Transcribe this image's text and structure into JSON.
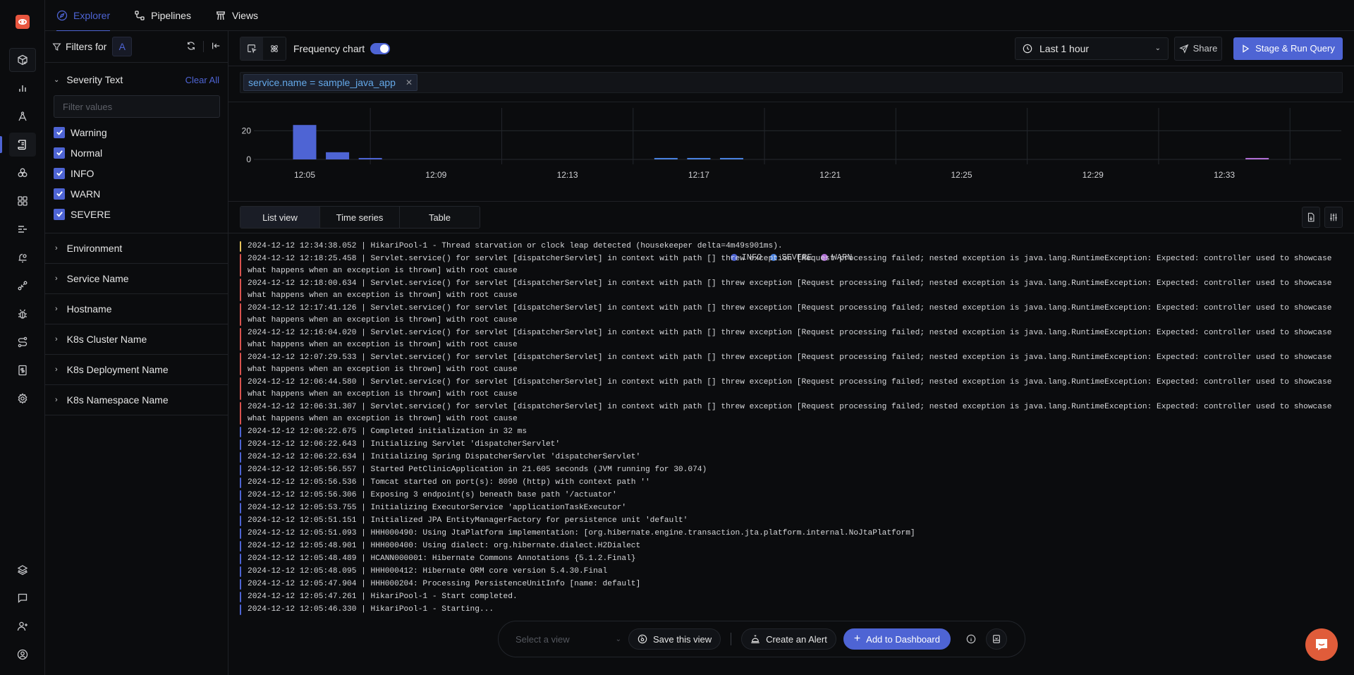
{
  "nav": {
    "top_icons": [
      "new-package-icon",
      "bar-chart-icon",
      "traces-compass-icon",
      "logs-scroll-icon",
      "exceptions-icon",
      "dashboards-grid-icon",
      "messaging-queues-icon",
      "alerts-bell-icon",
      "integrations-plug-icon",
      "bug-icon",
      "pipelines-route-icon",
      "billing-icon",
      "settings-gear-icon"
    ],
    "bottom_icons": [
      "layers-icon",
      "chat-icon",
      "invite-user-icon",
      "user-profile-icon"
    ],
    "active_index": 3
  },
  "tabs": [
    {
      "label": "Explorer",
      "icon": "compass-icon",
      "active": true
    },
    {
      "label": "Pipelines",
      "icon": "pipeline-nodes-icon",
      "active": false
    },
    {
      "label": "Views",
      "icon": "views-tower-icon",
      "active": false
    }
  ],
  "filters": {
    "title": "Filters for",
    "query_label": "A",
    "severity": {
      "label": "Severity Text",
      "clear_all": "Clear All",
      "search_placeholder": "Filter values",
      "options": [
        {
          "label": "Warning",
          "checked": true
        },
        {
          "label": "Normal",
          "checked": true
        },
        {
          "label": "INFO",
          "checked": true
        },
        {
          "label": "WARN",
          "checked": true
        },
        {
          "label": "SEVERE",
          "checked": true
        }
      ]
    },
    "facets": [
      "Environment",
      "Service Name",
      "Hostname",
      "K8s Cluster Name",
      "K8s Deployment Name",
      "K8s Namespace Name"
    ]
  },
  "toolbar": {
    "frequency_chart_label": "Frequency chart",
    "frequency_chart_on": true,
    "time_range": "Last 1 hour",
    "share_label": "Share",
    "run_label": "Stage & Run Query"
  },
  "query": {
    "chips": [
      "service.name = sample_java_app"
    ]
  },
  "chart_data": {
    "type": "bar",
    "title": "",
    "xlabel": "",
    "ylabel": "",
    "ylim": [
      0,
      30
    ],
    "y_ticks": [
      0,
      20
    ],
    "x_tick_labels": [
      "12:05",
      "12:09",
      "12:13",
      "12:17",
      "12:21",
      "12:25",
      "12:29",
      "12:33"
    ],
    "legend": "bottom-center",
    "grid": true,
    "series": [
      {
        "name": "INFO",
        "color": "#4e64d4",
        "points": [
          {
            "x": "12:05",
            "y": 24
          },
          {
            "x": "12:06",
            "y": 5
          },
          {
            "x": "12:07",
            "y": 1
          }
        ]
      },
      {
        "name": "SEVERE",
        "color": "#4a82e0",
        "points": [
          {
            "x": "12:16",
            "y": 1
          },
          {
            "x": "12:17",
            "y": 1
          },
          {
            "x": "12:18",
            "y": 1
          }
        ]
      },
      {
        "name": "WARN",
        "color": "#b16fd6",
        "points": [
          {
            "x": "12:34",
            "y": 1
          }
        ]
      }
    ]
  },
  "views": {
    "tabs": [
      {
        "label": "List view",
        "active": true
      },
      {
        "label": "Time series",
        "active": false
      },
      {
        "label": "Table",
        "active": false
      }
    ]
  },
  "severity_colors": {
    "warn": "#e8c35a",
    "error": "#d9534f",
    "info": "#4e64d4"
  },
  "logs": [
    {
      "level": "warn",
      "text": "2024-12-12 12:34:38.052 | HikariPool-1 - Thread starvation or clock leap detected (housekeeper delta=4m49s901ms)."
    },
    {
      "level": "error",
      "text": "2024-12-12 12:18:25.458 | Servlet.service() for servlet [dispatcherServlet] in context with path [] threw exception [Request processing failed; nested exception is java.lang.RuntimeException: Expected: controller used to showcase what happens when an exception is thrown] with root cause"
    },
    {
      "level": "error",
      "text": "2024-12-12 12:18:00.634 | Servlet.service() for servlet [dispatcherServlet] in context with path [] threw exception [Request processing failed; nested exception is java.lang.RuntimeException: Expected: controller used to showcase what happens when an exception is thrown] with root cause"
    },
    {
      "level": "error",
      "text": "2024-12-12 12:17:41.126 | Servlet.service() for servlet [dispatcherServlet] in context with path [] threw exception [Request processing failed; nested exception is java.lang.RuntimeException: Expected: controller used to showcase what happens when an exception is thrown] with root cause"
    },
    {
      "level": "error",
      "text": "2024-12-12 12:16:04.020 | Servlet.service() for servlet [dispatcherServlet] in context with path [] threw exception [Request processing failed; nested exception is java.lang.RuntimeException: Expected: controller used to showcase what happens when an exception is thrown] with root cause"
    },
    {
      "level": "error",
      "text": "2024-12-12 12:07:29.533 | Servlet.service() for servlet [dispatcherServlet] in context with path [] threw exception [Request processing failed; nested exception is java.lang.RuntimeException: Expected: controller used to showcase what happens when an exception is thrown] with root cause"
    },
    {
      "level": "error",
      "text": "2024-12-12 12:06:44.580 | Servlet.service() for servlet [dispatcherServlet] in context with path [] threw exception [Request processing failed; nested exception is java.lang.RuntimeException: Expected: controller used to showcase what happens when an exception is thrown] with root cause"
    },
    {
      "level": "error",
      "text": "2024-12-12 12:06:31.307 | Servlet.service() for servlet [dispatcherServlet] in context with path [] threw exception [Request processing failed; nested exception is java.lang.RuntimeException: Expected: controller used to showcase what happens when an exception is thrown] with root cause"
    },
    {
      "level": "info",
      "text": "2024-12-12 12:06:22.675 | Completed initialization in 32 ms"
    },
    {
      "level": "info",
      "text": "2024-12-12 12:06:22.643 | Initializing Servlet 'dispatcherServlet'"
    },
    {
      "level": "info",
      "text": "2024-12-12 12:06:22.634 | Initializing Spring DispatcherServlet 'dispatcherServlet'"
    },
    {
      "level": "info",
      "text": "2024-12-12 12:05:56.557 | Started PetClinicApplication in 21.605 seconds (JVM running for 30.074)"
    },
    {
      "level": "info",
      "text": "2024-12-12 12:05:56.536 | Tomcat started on port(s): 8090 (http) with context path ''"
    },
    {
      "level": "info",
      "text": "2024-12-12 12:05:56.306 | Exposing 3 endpoint(s) beneath base path '/actuator'"
    },
    {
      "level": "info",
      "text": "2024-12-12 12:05:53.755 | Initializing ExecutorService 'applicationTaskExecutor'"
    },
    {
      "level": "info",
      "text": "2024-12-12 12:05:51.151 | Initialized JPA EntityManagerFactory for persistence unit 'default'"
    },
    {
      "level": "info",
      "text": "2024-12-12 12:05:51.093 | HHH000490: Using JtaPlatform implementation: [org.hibernate.engine.transaction.jta.platform.internal.NoJtaPlatform]"
    },
    {
      "level": "info",
      "text": "2024-12-12 12:05:48.901 | HHH000400: Using dialect: org.hibernate.dialect.H2Dialect"
    },
    {
      "level": "info",
      "text": "2024-12-12 12:05:48.489 | HCANN000001: Hibernate Commons Annotations {5.1.2.Final}"
    },
    {
      "level": "info",
      "text": "2024-12-12 12:05:48.095 | HHH000412: Hibernate ORM core version 5.4.30.Final"
    },
    {
      "level": "info",
      "text": "2024-12-12 12:05:47.904 | HHH000204: Processing PersistenceUnitInfo [name: default]"
    },
    {
      "level": "info",
      "text": "2024-12-12 12:05:47.261 | HikariPool-1 - Start completed."
    },
    {
      "level": "info",
      "text": "2024-12-12 12:05:46.330 | HikariPool-1 - Starting..."
    }
  ],
  "actionbar": {
    "select_view_placeholder": "Select a view",
    "save_view_label": "Save this view",
    "create_alert_label": "Create an Alert",
    "add_dashboard_label": "Add to Dashboard"
  }
}
